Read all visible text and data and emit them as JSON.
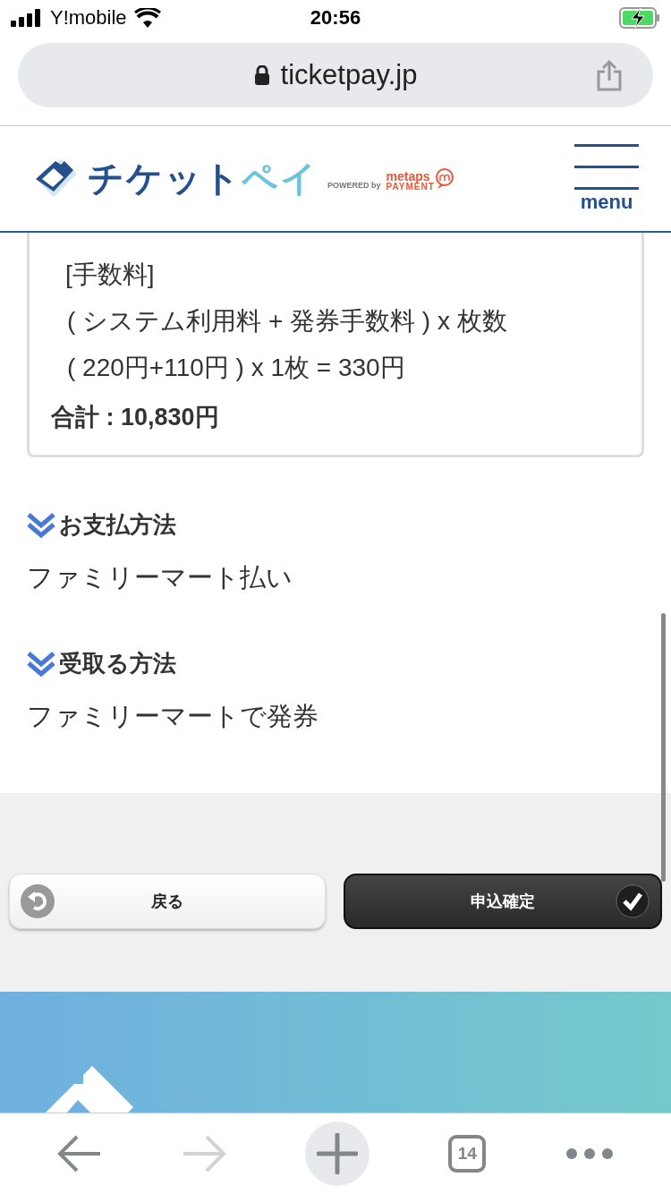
{
  "status_bar": {
    "carrier": "Y!mobile",
    "time": "20:56"
  },
  "address_bar": {
    "url": "ticketpay.jp"
  },
  "header": {
    "logo_text_1": "チケット",
    "logo_text_2": "ペイ",
    "powered": "POWERED by",
    "partner_1": "metaps",
    "partner_2": "PAYMENT",
    "menu_label": "menu"
  },
  "fee_card": {
    "lines": [
      "[手数料]",
      "( システム利用料 + 発券手数料 ) x 枚数",
      "( 220円+110円 ) x 1枚 = 330円"
    ],
    "total": "合計 : 10,830円"
  },
  "sections": [
    {
      "heading": "お支払方法",
      "value": "ファミリーマート払い"
    },
    {
      "heading": "受取る方法",
      "value": "ファミリーマートで発券"
    }
  ],
  "buttons": [
    {
      "kind": "back",
      "label": "戻る"
    },
    {
      "kind": "confirm",
      "label": "申込確定"
    }
  ],
  "browser_toolbar": {
    "tab_count": "14",
    "forward_disabled": true
  }
}
